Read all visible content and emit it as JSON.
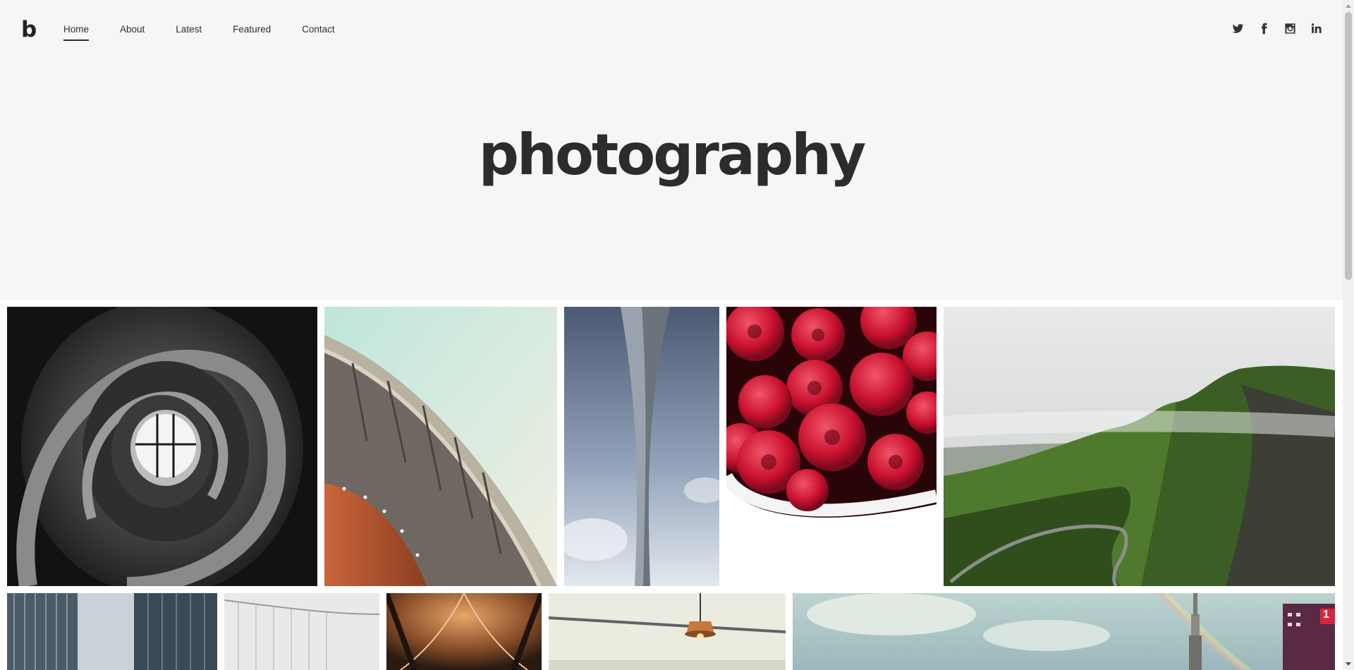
{
  "brand": {
    "logo": "b"
  },
  "nav": {
    "items": [
      {
        "label": "Home",
        "active": true
      },
      {
        "label": "About",
        "active": false
      },
      {
        "label": "Latest",
        "active": false
      },
      {
        "label": "Featured",
        "active": false
      },
      {
        "label": "Contact",
        "active": false
      }
    ]
  },
  "social": {
    "icons": [
      "twitter-icon",
      "facebook-icon",
      "instagram-icon",
      "linkedin-icon"
    ]
  },
  "hero": {
    "title": "photography"
  },
  "gallery": {
    "row1": [
      "spiral-staircase-photo",
      "curved-building-photo",
      "tall-tower-photo",
      "raspberries-photo",
      "green-mountains-photo"
    ],
    "row2": [
      "skyscrapers-photo",
      "bridge-fog-photo",
      "arched-ceiling-photo",
      "pendant-lamp-photo",
      "city-rainbow-photo"
    ],
    "row2_sign_text": "1"
  },
  "colors": {
    "hero_bg": "#f6f6f6",
    "text": "#2b2b2b",
    "page_bg": "#ffffff"
  }
}
